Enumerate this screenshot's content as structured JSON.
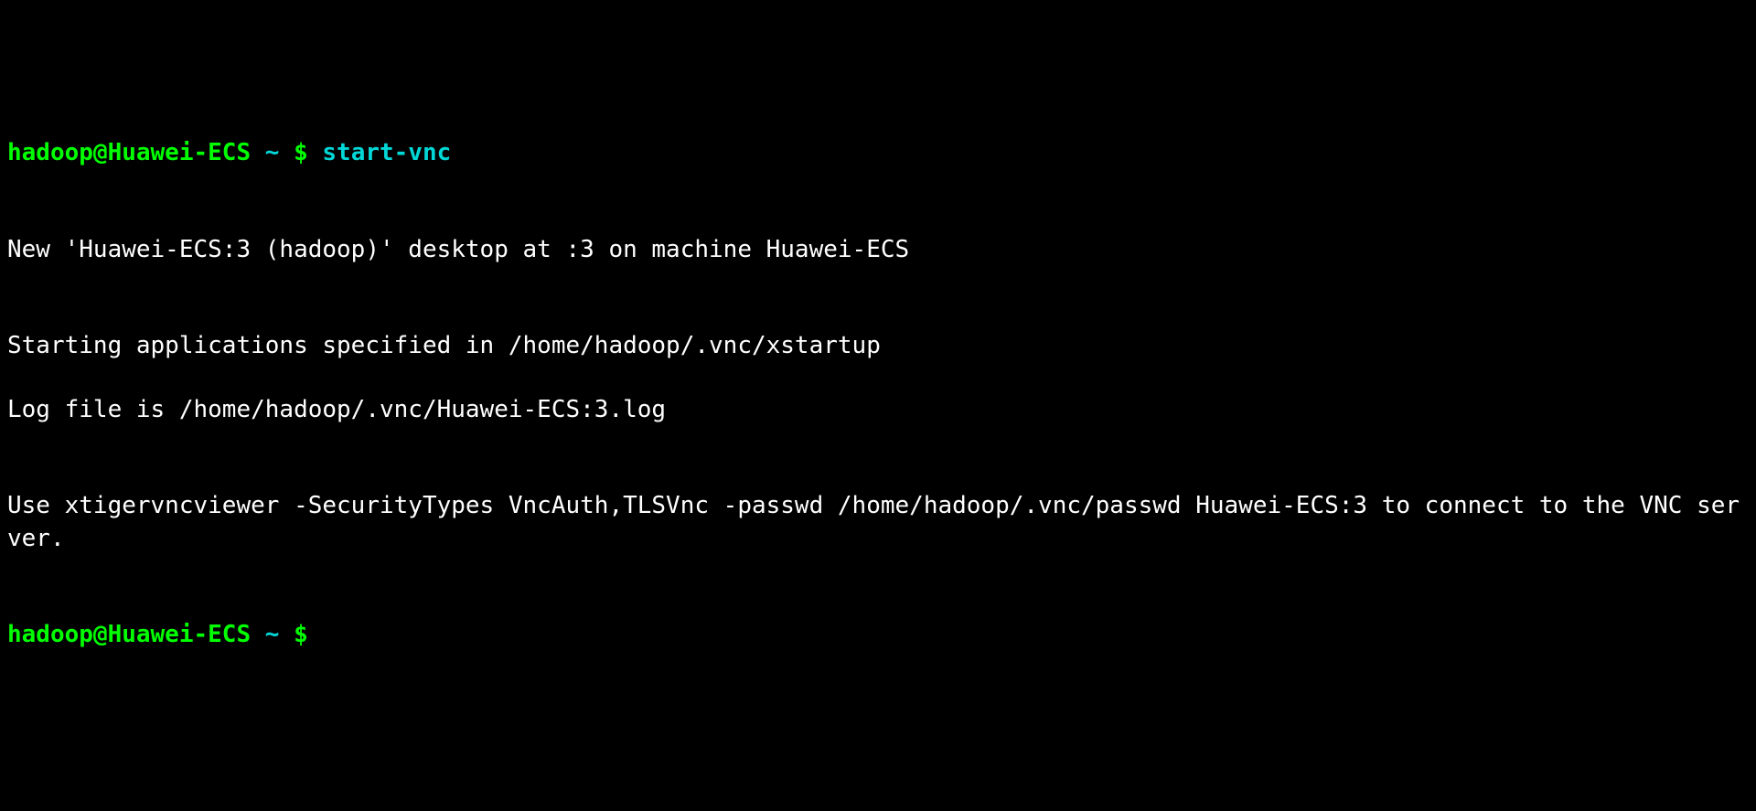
{
  "prompt1": {
    "user_host": "hadoop@Huawei-ECS",
    "sep1": " ",
    "path": "~",
    "sep2": " ",
    "dollar": "$ ",
    "command": "start-vnc"
  },
  "output": {
    "blank1": "",
    "line1": "New 'Huawei-ECS:3 (hadoop)' desktop at :3 on machine Huawei-ECS",
    "blank2": "",
    "line2": "Starting applications specified in /home/hadoop/.vnc/xstartup",
    "line3": "Log file is /home/hadoop/.vnc/Huawei-ECS:3.log",
    "blank3": "",
    "line4": "Use xtigervncviewer -SecurityTypes VncAuth,TLSVnc -passwd /home/hadoop/.vnc/passwd Huawei-ECS:3 to connect to the VNC server.",
    "blank4": ""
  },
  "prompt2": {
    "user_host": "hadoop@Huawei-ECS",
    "sep1": " ",
    "path": "~",
    "sep2": " ",
    "dollar": "$ "
  }
}
